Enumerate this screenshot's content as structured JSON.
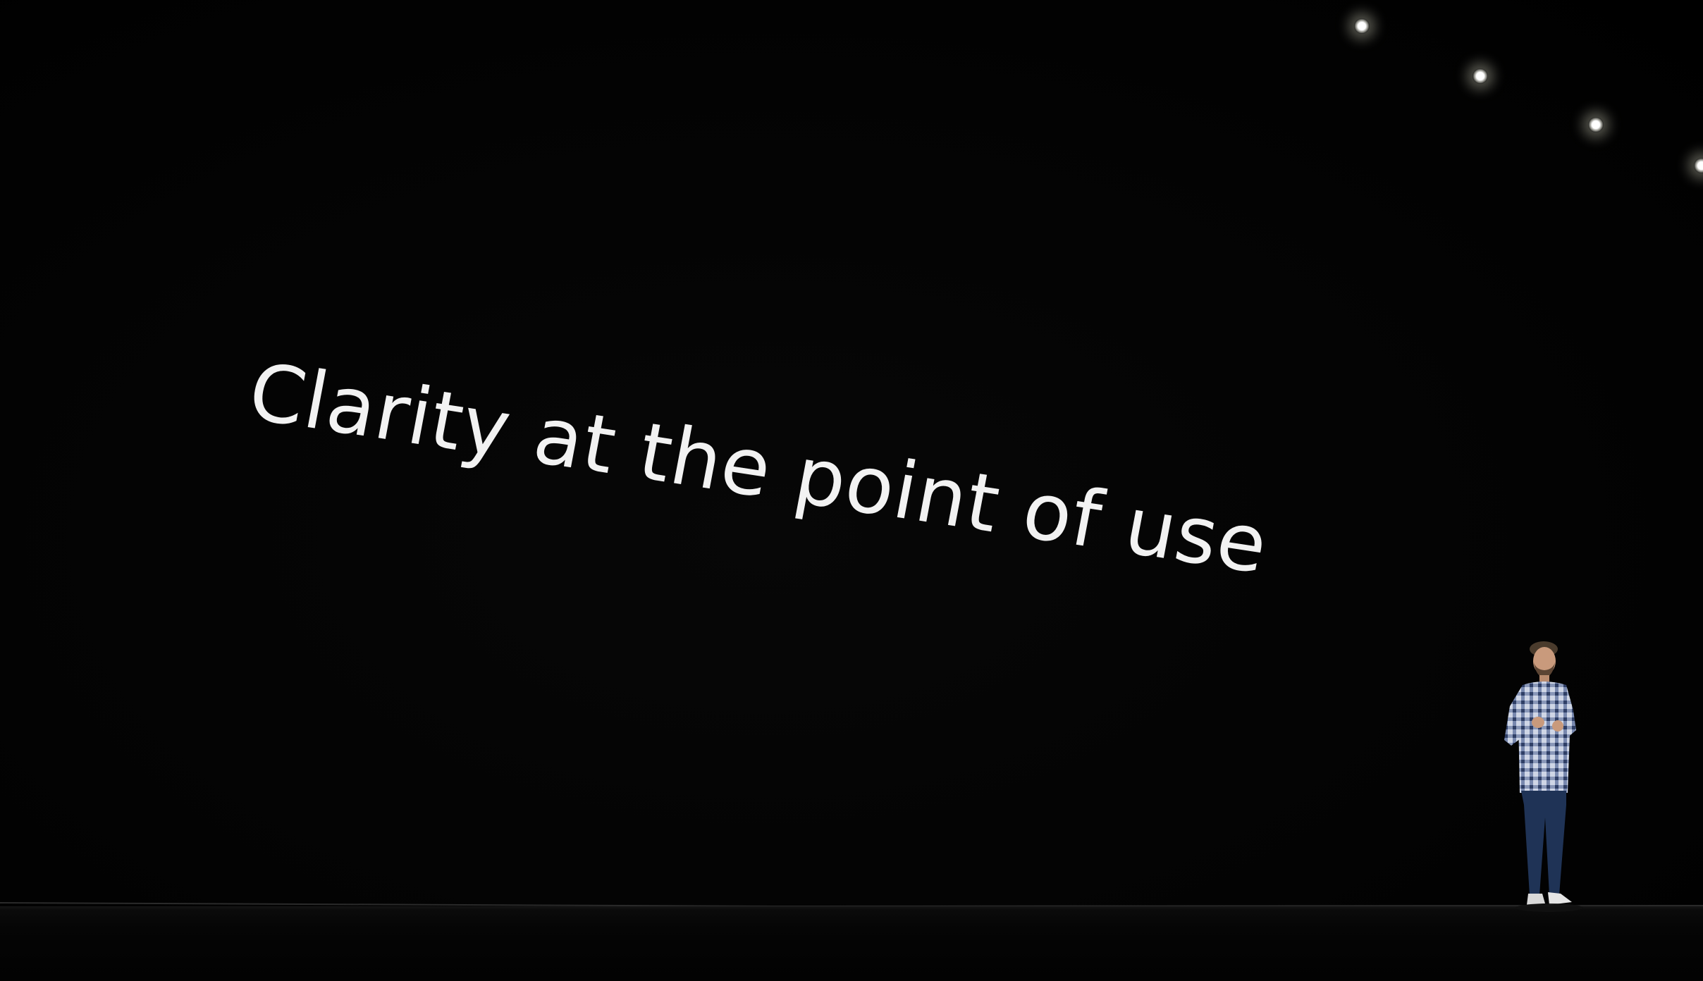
{
  "slide": {
    "headline": "Clarity at the point of use"
  },
  "scene": {
    "background_color": "#000000",
    "text_color": "#f2f2f2",
    "ceiling_light_count": 4,
    "presenter_shirt": "blue-white plaid",
    "presenter_pants": "dark blue jeans"
  }
}
